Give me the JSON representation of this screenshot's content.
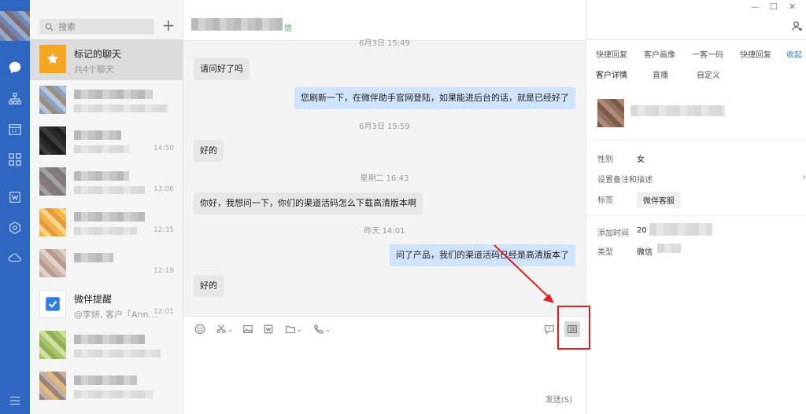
{
  "search": {
    "placeholder": "搜索"
  },
  "list": {
    "starred": {
      "name": "标记的聊天",
      "sub": "共4个聊天"
    },
    "items": [
      {
        "time": ""
      },
      {
        "time": "14:50"
      },
      {
        "time": "13:06"
      },
      {
        "time": "12:35"
      },
      {
        "time": "12:19"
      },
      {
        "name": "微伴提醒",
        "sub": "@李妍, 客户「Ann...",
        "time": "12:01"
      },
      {
        "time": ""
      },
      {
        "time": ""
      }
    ]
  },
  "chat": {
    "header_tag": "信",
    "messages": [
      {
        "type": "time",
        "text": "6月3日 15:49"
      },
      {
        "type": "in",
        "text": "请问好了吗"
      },
      {
        "type": "out",
        "text": "您刷新一下，在微伴助手官网登陆，如果能进后台的话，就是已经好了"
      },
      {
        "type": "time",
        "text": "6月3日 15:59"
      },
      {
        "type": "in",
        "text": "好的"
      },
      {
        "type": "time",
        "text": "星期二 16:43"
      },
      {
        "type": "in",
        "text": "你好，我想问一下，你们的渠道活码怎么下载高清版本啊"
      },
      {
        "type": "time",
        "text": "昨天 14:01"
      },
      {
        "type": "out",
        "text": "问了产品，我们的渠道活码已经是高清版本了"
      },
      {
        "type": "in",
        "text": "好的"
      }
    ],
    "send_label": "发送(S)"
  },
  "right": {
    "tabs_row1": [
      "快捷回复",
      "客户画像",
      "一客一码",
      "快捷回复",
      "收起"
    ],
    "tabs_row2": [
      "客户详情",
      "直播",
      "自定义"
    ],
    "fields": {
      "gender_label": "性别",
      "gender_value": "女",
      "remark_label": "设置备注和描述",
      "tag_label": "标签",
      "tag_value": "微伴客服",
      "added_label": "添加时间",
      "added_value": "20",
      "type_label": "类型",
      "type_value": "微信"
    }
  },
  "colors": {
    "nav_bg": "#2e66c2",
    "accent": "#2f7de1",
    "highlight": "#e02020"
  }
}
